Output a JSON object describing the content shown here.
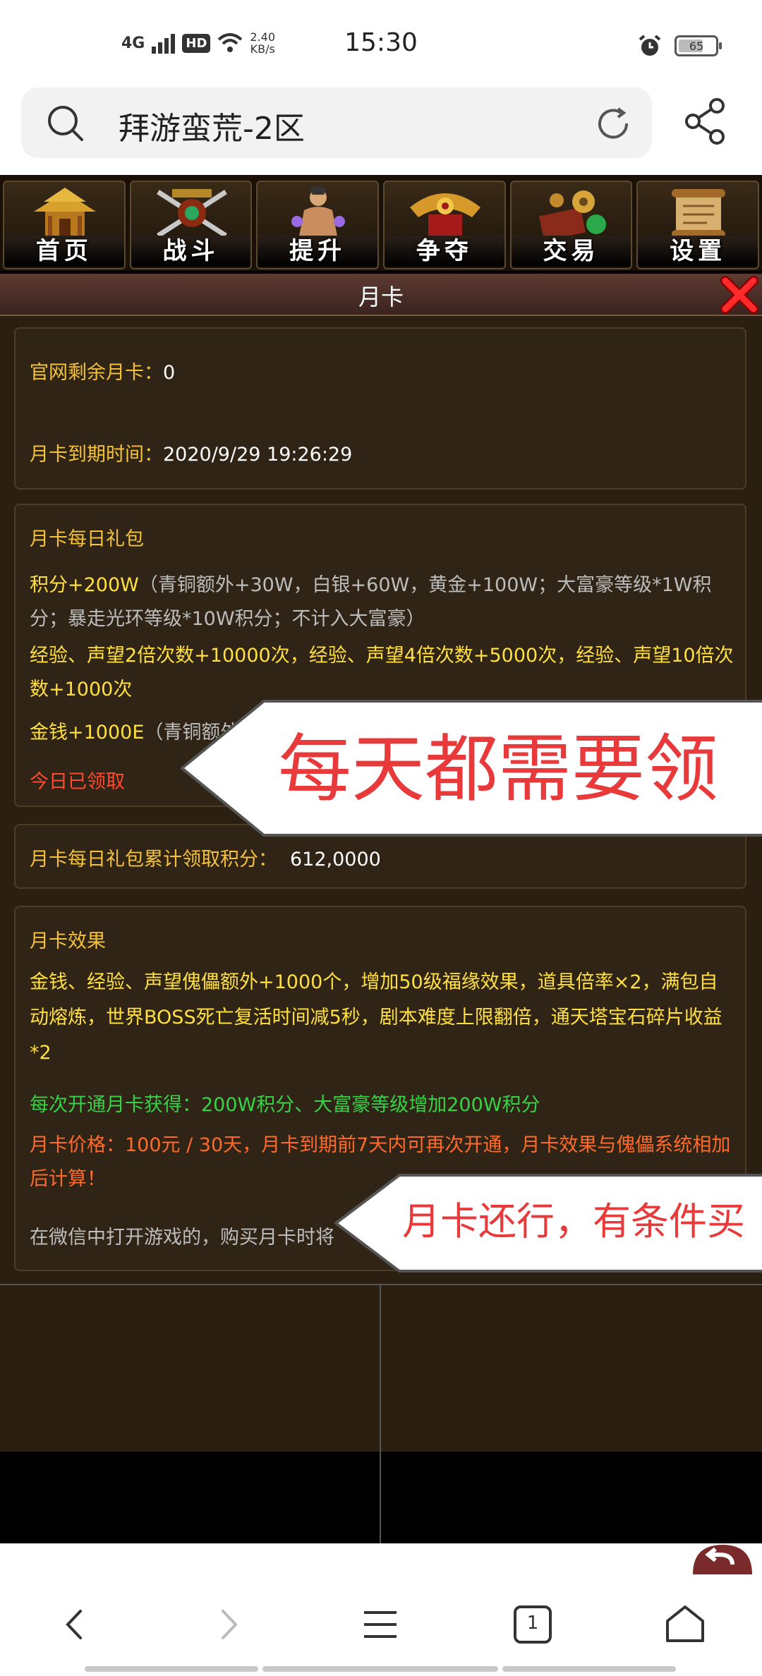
{
  "status_bar": {
    "network": "4G",
    "hd": "HD",
    "speed_value": "2.40",
    "speed_unit": "KB/s",
    "time": "15:30",
    "battery": "65"
  },
  "browser": {
    "page_title": "拜游蛮荒-2区"
  },
  "game_nav": [
    {
      "label": "首页",
      "icon": "palace-icon"
    },
    {
      "label": "战斗",
      "icon": "battle-icon"
    },
    {
      "label": "提升",
      "icon": "warrior-icon"
    },
    {
      "label": "争夺",
      "icon": "dragon-throne-icon"
    },
    {
      "label": "交易",
      "icon": "treasure-icon"
    },
    {
      "label": "设置",
      "icon": "scroll-icon"
    }
  ],
  "panel": {
    "title": "月卡",
    "info": {
      "remaining_label": "官网剩余月卡：",
      "remaining_value": "0",
      "expire_label": "月卡到期时间：",
      "expire_value": "2020/9/29 19:26:29"
    },
    "daily_gift": {
      "heading": "月卡每日礼包",
      "points_main": "积分+200W",
      "points_detail": "（青铜额外+30W，白银+60W，黄金+100W；大富豪等级*1W积分；暴走光环等级*10W积分；不计入大富豪）",
      "exp_line": "经验、声望2倍次数+10000次，经验、声望4倍次数+5000次，经验、声望10倍次数+1000次",
      "money_main": "金钱+1000E",
      "money_detail": "（青铜额外",
      "claimed": "今日已领取"
    },
    "accumulated": {
      "label": "月卡每日礼包累计领取积分：",
      "value": "612,0000"
    },
    "effects": {
      "heading": "月卡效果",
      "desc": "金钱、经验、声望傀儡额外+1000个，增加50级福缘效果，道具倍率×2，满包自动熔炼，世界BOSS死亡复活时间减5秒，剧本难度上限翻倍，通天塔宝石碎片收益*2",
      "purchase_bonus": "每次开通月卡获得：200W积分、大富豪等级增加200W积分",
      "price": "月卡价格：100元 / 30天，月卡到期前7天内可再次开通，月卡效果与傀儡系统相加后计算！",
      "wechat_note": "在微信中打开游戏的，购买月卡时将"
    }
  },
  "callouts": {
    "daily": "每天都需要领",
    "conditional": "月卡还行，有条件买"
  },
  "bottom_nav": {
    "tab_count": "1"
  },
  "colors": {
    "gold": "#f5c23a",
    "yellow": "#ffe040",
    "red": "#ff4a30",
    "green": "#38d248",
    "callout_red": "#e83a3a",
    "panel_bg": "#2b1f12"
  }
}
